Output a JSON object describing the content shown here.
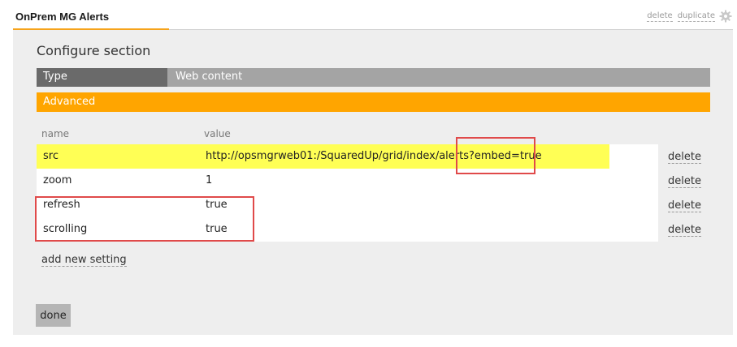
{
  "header": {
    "title": "OnPrem MG Alerts",
    "delete_link": "delete",
    "duplicate_link": "duplicate"
  },
  "panel": {
    "section_title": "Configure section",
    "type_label": "Type",
    "type_value": "Web content",
    "advanced_label": "Advanced",
    "col_name": "name",
    "col_value": "value",
    "settings": [
      {
        "name": "src",
        "value": "http://opsmgrweb01:/SquaredUp/grid/index/alerts?embed=true",
        "delete": "delete"
      },
      {
        "name": "zoom",
        "value": "1",
        "delete": "delete"
      },
      {
        "name": "refresh",
        "value": "true",
        "delete": "delete"
      },
      {
        "name": "scrolling",
        "value": "true",
        "delete": "delete"
      }
    ],
    "add_setting": "add new setting",
    "done_label": "done"
  },
  "colors": {
    "accent": "#ffa500",
    "highlight": "#ffff55",
    "annotation": "#e04a4a"
  }
}
